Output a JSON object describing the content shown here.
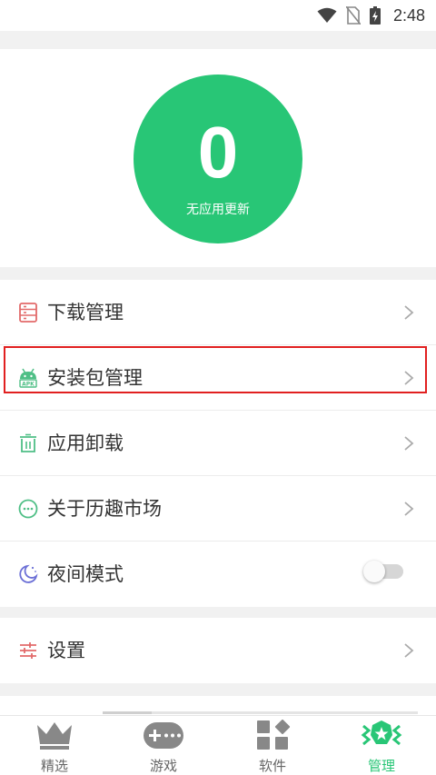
{
  "status_bar": {
    "time": "2:48"
  },
  "update_panel": {
    "count": "0",
    "message": "无应用更新"
  },
  "menu": {
    "items": [
      {
        "label": "下载管理"
      },
      {
        "label": "安装包管理"
      },
      {
        "label": "应用卸载"
      },
      {
        "label": "关于历趣市场"
      },
      {
        "label": "夜间模式",
        "toggle_on": false
      }
    ],
    "settings": {
      "label": "设置"
    }
  },
  "scroll_indicator": {
    "position": 0
  },
  "bottom_nav": {
    "tabs": [
      {
        "label": "精选",
        "icon": "crown-icon"
      },
      {
        "label": "游戏",
        "icon": "gamepad-icon"
      },
      {
        "label": "软件",
        "icon": "apps-grid-icon"
      },
      {
        "label": "管理",
        "icon": "manage-badge-icon",
        "active": true
      }
    ]
  },
  "colors": {
    "accent": "#28c676",
    "highlight": "#e12020",
    "download_icon": "#e26a6a",
    "android_icon": "#4fbf86",
    "night_icon": "#6b6fd6"
  }
}
